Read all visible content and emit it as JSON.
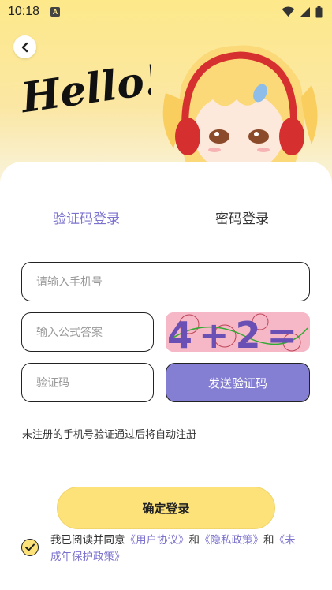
{
  "status": {
    "time": "10:18",
    "a_badge": "A"
  },
  "header": {
    "hello_text": "Hello!"
  },
  "tabs": [
    {
      "label": "验证码登录",
      "active": true
    },
    {
      "label": "密码登录",
      "active": false
    }
  ],
  "form": {
    "phone_placeholder": "请输入手机号",
    "formula_placeholder": "输入公式答案",
    "captcha_text": "4+2=",
    "code_placeholder": "验证码",
    "send_code_label": "发送验证码"
  },
  "hint": "未注册的手机号验证通过后将自动注册",
  "login_button": "确定登录",
  "agreement": {
    "prefix": "我已阅读并同意",
    "user_agreement": "《用户协议》",
    "and1": "和",
    "privacy_policy": "《隐私政策》",
    "and2": "和",
    "minor_policy": "《未成年保护政策》"
  },
  "colors": {
    "accent": "#857fd3",
    "accent_text": "#7c73cf",
    "yellow": "#fde27a"
  }
}
